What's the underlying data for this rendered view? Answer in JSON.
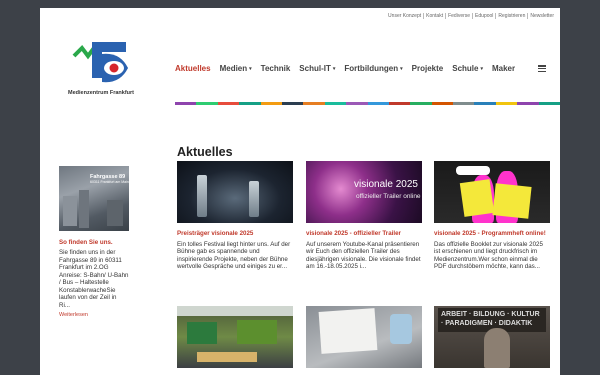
{
  "top_links": [
    "Unser Konzept",
    "Kontakt",
    "Fediverse",
    "Edupool",
    "Registrieren",
    "Newsletter"
  ],
  "logo": {
    "text": "Medienzentrum Frankfurt"
  },
  "nav": [
    {
      "label": "Aktuelles",
      "active": true,
      "dropdown": false
    },
    {
      "label": "Medien",
      "active": false,
      "dropdown": true
    },
    {
      "label": "Technik",
      "active": false,
      "dropdown": false
    },
    {
      "label": "Schul-IT",
      "active": false,
      "dropdown": true
    },
    {
      "label": "Fortbildungen",
      "active": false,
      "dropdown": true
    },
    {
      "label": "Projekte",
      "active": false,
      "dropdown": false
    },
    {
      "label": "Schule",
      "active": false,
      "dropdown": true
    },
    {
      "label": "Maker",
      "active": false,
      "dropdown": false
    }
  ],
  "nav_caret": "▾",
  "colors": {
    "accent": "#c0392b",
    "bar": [
      "#8e44ad",
      "#2ecc71",
      "#e74c3c",
      "#16a085",
      "#f39c12",
      "#2c3e50",
      "#e67e22",
      "#1abc9c",
      "#9b59b6",
      "#3498db",
      "#c0392b",
      "#27ae60",
      "#d35400",
      "#7f8c8d",
      "#2980b9",
      "#f1c40f",
      "#8e44ad",
      "#16a085"
    ]
  },
  "heading": "Aktuelles",
  "sidebar": {
    "image_label": "Fahrgasse 89",
    "image_sublabel": "60311 Frankfurt am Main",
    "title": "So finden Sie uns.",
    "text": "Sie finden uns in der Fahrgasse 89 in 60311 Frankfurt im 2.OG Anreise: S-Bahn/ U-Bahn / Bus – Haltestelle KonstablerwacheSie laufen von der Zeil in Ri...",
    "more": "Weiterlesen"
  },
  "cards": [
    {
      "title": "Preisträger visionale 2025",
      "text": "Ein tolles Festival liegt hinter uns. Auf der Bühne gab es spannende und inspirierende Projekte, neben der Bühne wertvolle Gespräche und einiges zu er..."
    },
    {
      "title": "visionale 2025 - offizieller Trailer",
      "text": "Auf unserem Youtube-Kanal präsentieren wir Euch den offiziellen Trailer des diesjährigen visionale. Die visionale findet am 16.-18.05.2025 i...",
      "image_title": "visionale 2025",
      "image_subtitle": "offizieller Trailer online"
    },
    {
      "title": "visionale 2025 - Programmheft online!",
      "text": "Das offizielle Booklet zur visionale 2025 ist erschienen und liegt druckfrisch im Medienzentrum.Wer schon einmal die PDF durchstöbern möchte, kann das..."
    },
    {
      "title": "",
      "text": ""
    },
    {
      "title": "",
      "text": ""
    },
    {
      "title": "",
      "text": "",
      "image_title": "ARBEIT · BILDUNG · KULTUR · PARADIGMEN · DIDAKTIK"
    }
  ]
}
